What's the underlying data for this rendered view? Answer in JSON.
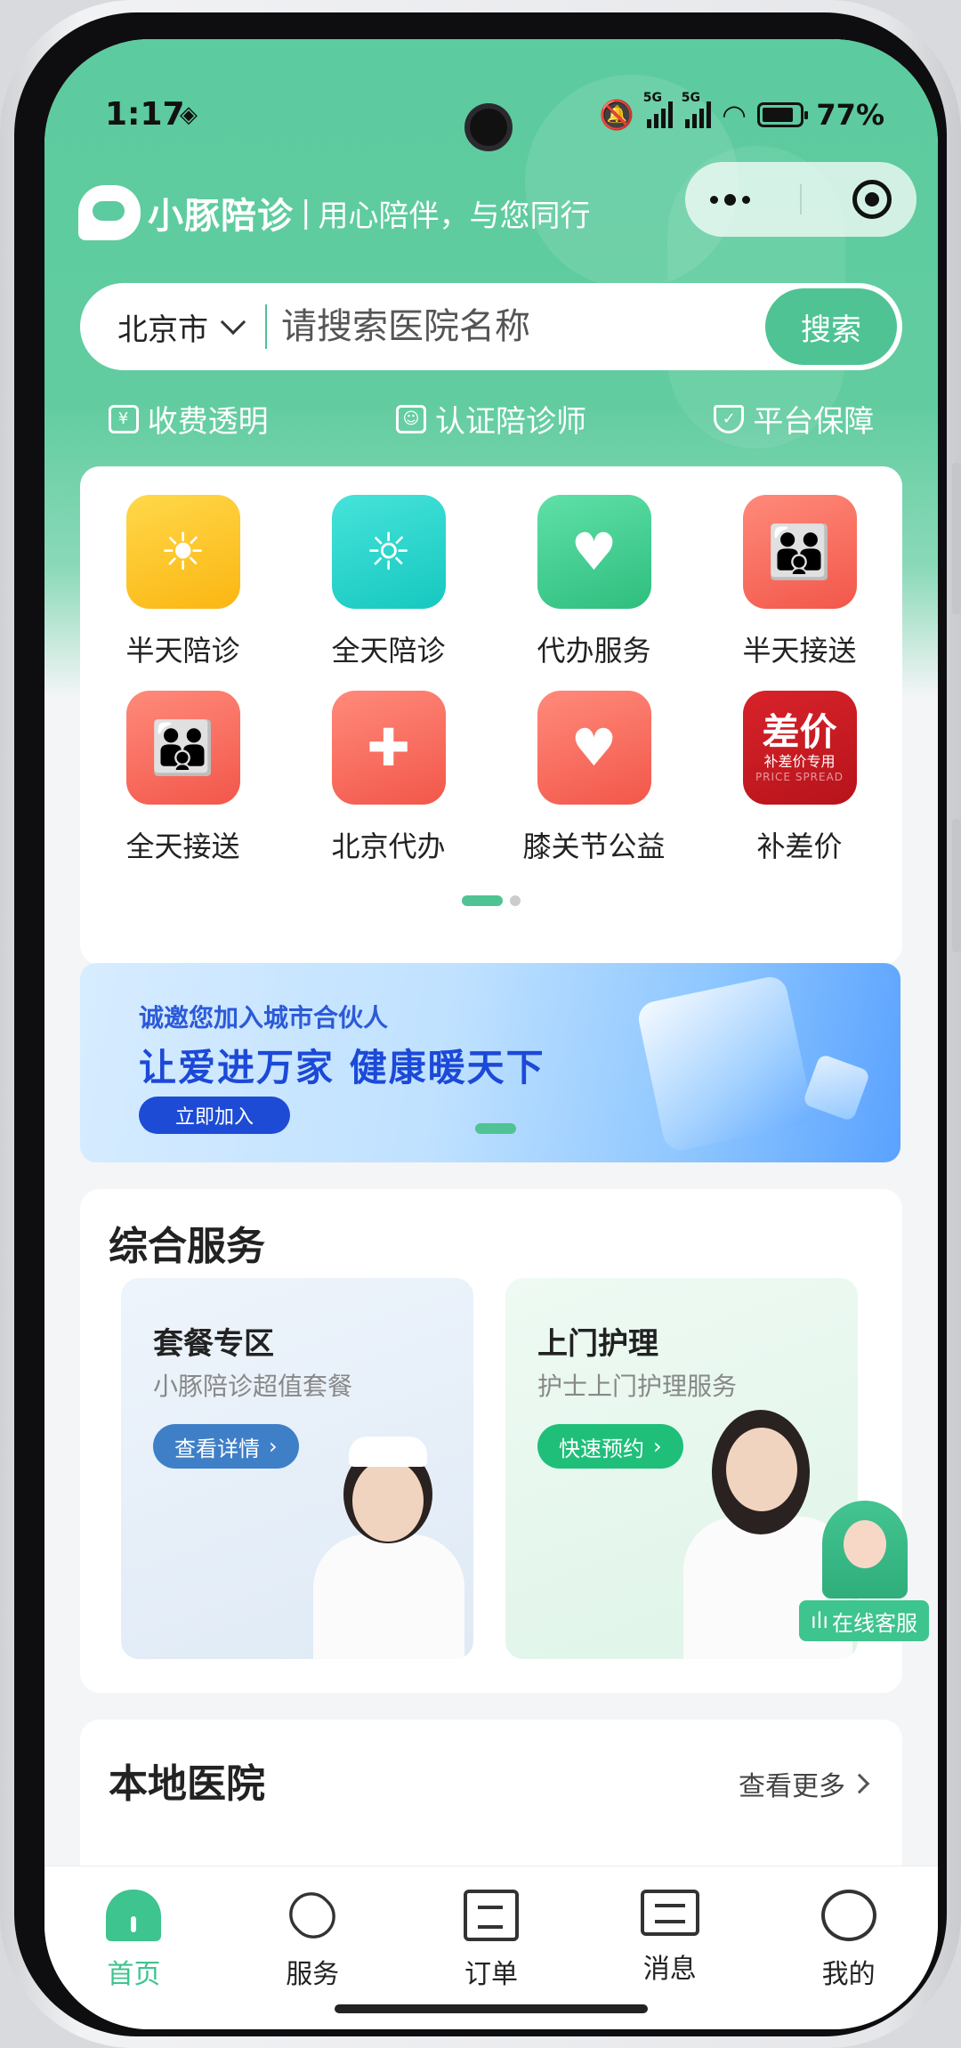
{
  "status_bar": {
    "time": "1:17",
    "signal1_label": "5G",
    "signal2_label": "5G",
    "battery": "77%"
  },
  "header": {
    "brand_name": "小豚陪诊",
    "separator": "|",
    "slogan": "用心陪伴，与您同行"
  },
  "search": {
    "city": "北京市",
    "placeholder": "请搜索医院名称",
    "button_label": "搜索"
  },
  "features": [
    {
      "icon": "yuan-receipt-icon",
      "label": "收费透明"
    },
    {
      "icon": "id-card-icon",
      "label": "认证陪诊师"
    },
    {
      "icon": "shield-check-icon",
      "label": "平台保障"
    }
  ],
  "grid_items": [
    {
      "label": "半天陪诊",
      "icon": "half-sun-heart-icon",
      "color": "#fbb612"
    },
    {
      "label": "全天陪诊",
      "icon": "sun-heart-icon",
      "color": "#16c8c0"
    },
    {
      "label": "代办服务",
      "icon": "hand-heart-icon",
      "color": "#2fbe7e"
    },
    {
      "label": "半天接送",
      "icon": "parent-child-icon",
      "color": "#f2574a"
    },
    {
      "label": "全天接送",
      "icon": "parent-child-icon",
      "color": "#f2574a"
    },
    {
      "label": "北京代办",
      "icon": "user-plus-icon",
      "color": "#f2574a"
    },
    {
      "label": "膝关节公益",
      "icon": "hands-heart-icon",
      "color": "#f2574a"
    },
    {
      "label": "补差价",
      "icon": "price-spread-tile",
      "color": "#b7131b"
    }
  ],
  "price_tile": {
    "big": "差价",
    "small": "补差价专用",
    "english": "PRICE SPREAD"
  },
  "banner": {
    "line1": "诚邀您加入城市合伙人",
    "line2": "让爱进万家  健康暖天下",
    "button": "立即加入"
  },
  "comprehensive": {
    "title": "综合服务",
    "cards": [
      {
        "title": "套餐专区",
        "subtitle": "小豚陪诊超值套餐",
        "button": "查看详情"
      },
      {
        "title": "上门护理",
        "subtitle": "护士上门护理服务",
        "button": "快速预约"
      }
    ]
  },
  "support": {
    "label": "在线客服"
  },
  "hospitals": {
    "title": "本地医院",
    "more": "查看更多"
  },
  "tabbar": [
    {
      "label": "首页",
      "icon": "home-icon",
      "active": true
    },
    {
      "label": "服务",
      "icon": "handshake-heart-icon",
      "active": false
    },
    {
      "label": "订单",
      "icon": "order-doc-icon",
      "active": false
    },
    {
      "label": "消息",
      "icon": "message-icon",
      "active": false
    },
    {
      "label": "我的",
      "icon": "profile-icon",
      "active": false
    }
  ],
  "colors": {
    "brand_green": "#4fc394",
    "banner_blue": "#1d4bd6"
  }
}
